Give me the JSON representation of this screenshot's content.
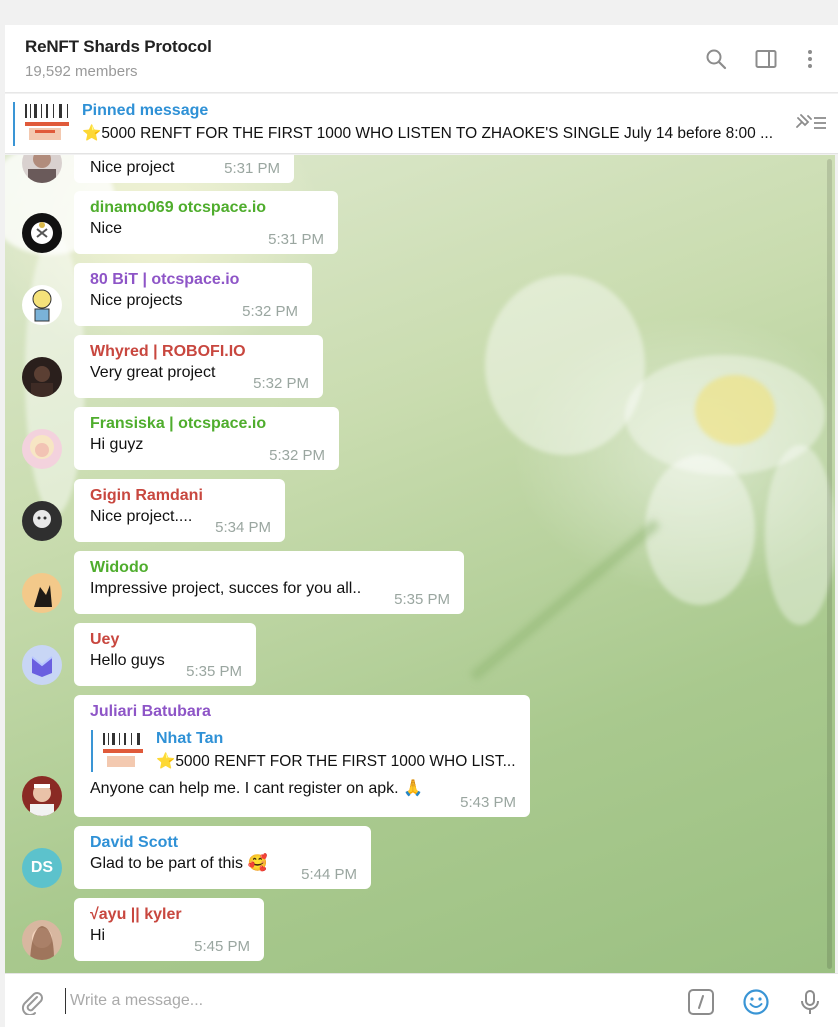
{
  "header": {
    "title": "ReNFT Shards Protocol",
    "members": "19,592 members",
    "icons": [
      "search-icon",
      "sidebar-toggle-icon",
      "more-vertical-icon"
    ]
  },
  "pinned": {
    "label": "Pinned message",
    "text": "5000 RENFT FOR THE FIRST 1000 WHO LISTEN TO ZHAOKE'S SINGLE July 14 before 8:00 ...",
    "emoji": "star-emoji",
    "icon": "unpin-icon"
  },
  "messages": [
    {
      "name": "",
      "text": "Nice project",
      "time": "5:31 PM",
      "color": "#333333"
    },
    {
      "name": "dinamo069 otcspace.io",
      "text": "Nice",
      "time": "5:31 PM",
      "color": "#4fad2d"
    },
    {
      "name": "80 BiT | otcspace.io",
      "text": "Nice projects",
      "time": "5:32 PM",
      "color": "#8e55c7"
    },
    {
      "name": "Whyred | ROBOFI.IO",
      "text": "Very great project",
      "time": "5:32 PM",
      "color": "#c8473f"
    },
    {
      "name": "Fransiska | otcspace.io",
      "text": "Hi guyz",
      "time": "5:32 PM",
      "color": "#4fad2d"
    },
    {
      "name": "Gigin Ramdani",
      "text": "Nice project....",
      "time": "5:34 PM",
      "color": "#c8473f"
    },
    {
      "name": "Widodo",
      "text": "Impressive project, succes for you all..",
      "time": "5:35 PM",
      "color": "#4fad2d"
    },
    {
      "name": "Uey",
      "text": "Hello guys",
      "time": "5:35 PM",
      "color": "#c8473f"
    },
    {
      "name": "Juliari Batubara",
      "text": "Anyone can help me. I cant register on apk.",
      "time": "5:43 PM",
      "color": "#8e55c7",
      "reply": {
        "name": "Nhat Tan",
        "text": "5000 RENFT FOR THE FIRST 1000 WHO LIST..."
      }
    },
    {
      "name": "David Scott",
      "text": "Glad to be part of this",
      "time": "5:44 PM",
      "color": "#2f91d6",
      "initials": "DS"
    },
    {
      "name": "√ayu || kyler",
      "text": "Hi",
      "time": "5:45 PM",
      "color": "#c8473f"
    }
  ],
  "composer": {
    "placeholder": "Write a message...",
    "icons": [
      "attach-icon",
      "bot-command-icon",
      "emoji-icon",
      "microphone-icon"
    ]
  },
  "colors": {
    "accent": "#2f91d6",
    "avatar_ds": "#5cc2cc"
  }
}
